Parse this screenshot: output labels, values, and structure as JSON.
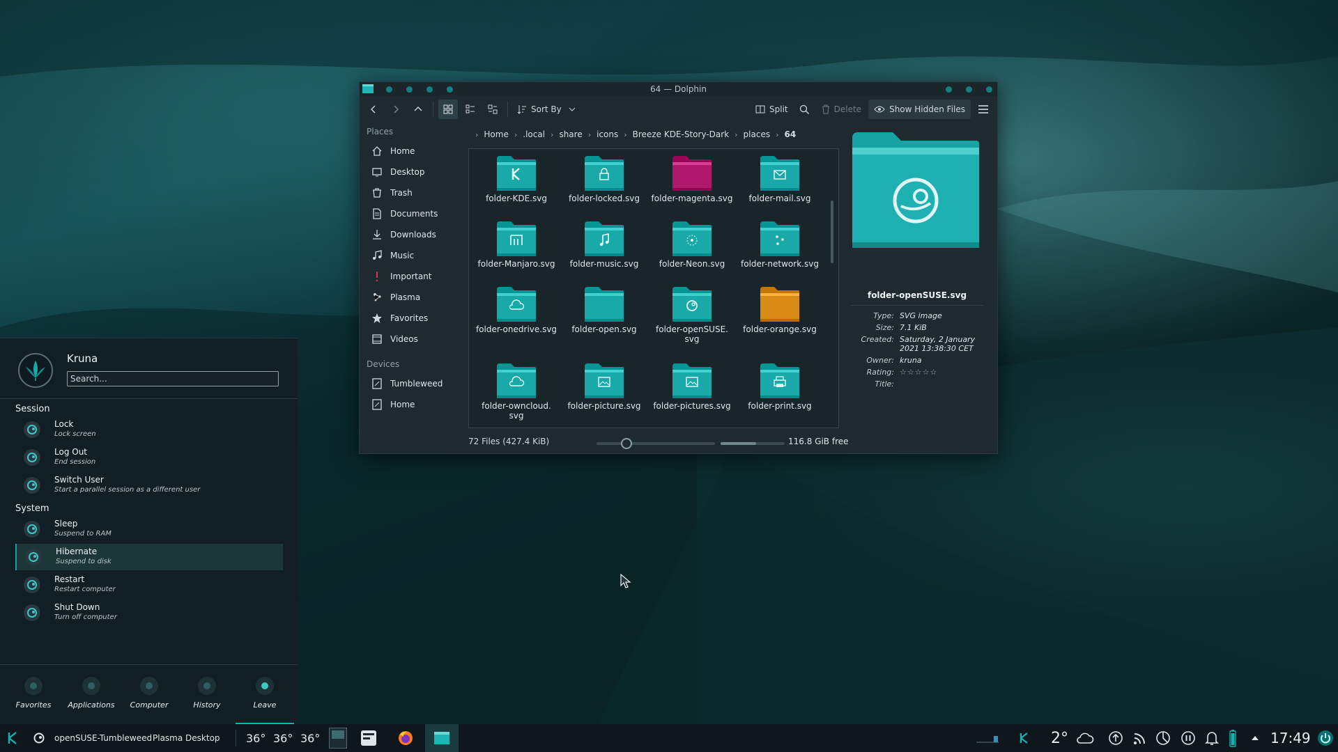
{
  "window": {
    "title": "64 — Dolphin",
    "toolbar": {
      "sort_label": "Sort By",
      "split_label": "Split",
      "delete_label": "Delete",
      "show_hidden_label": "Show Hidden Files"
    },
    "breadcrumbs": [
      "Home",
      ".local",
      "share",
      "icons",
      "Breeze KDE-Story-Dark",
      "places",
      "64"
    ],
    "places": {
      "section_places": "Places",
      "items": [
        {
          "label": "Home",
          "icon": "home-icon"
        },
        {
          "label": "Desktop",
          "icon": "desktop-icon"
        },
        {
          "label": "Trash",
          "icon": "trash-icon"
        },
        {
          "label": "Documents",
          "icon": "documents-icon"
        },
        {
          "label": "Downloads",
          "icon": "downloads-icon"
        },
        {
          "label": "Music",
          "icon": "music-icon"
        },
        {
          "label": "Important",
          "icon": "important-icon"
        },
        {
          "label": "Plasma",
          "icon": "plasma-icon"
        },
        {
          "label": "Favorites",
          "icon": "star-icon"
        },
        {
          "label": "Videos",
          "icon": "videos-icon"
        }
      ],
      "section_devices": "Devices",
      "devices": [
        {
          "label": "Tumbleweed",
          "icon": "drive-icon"
        },
        {
          "label": "Home",
          "icon": "drive-icon"
        }
      ]
    },
    "files": [
      {
        "name": "folder-KDE.svg",
        "color": "#1aa9a9",
        "emblem": "kde"
      },
      {
        "name": "folder-locked.svg",
        "color": "#1aa9a9",
        "emblem": "lock"
      },
      {
        "name": "folder-magenta.svg",
        "color": "#b0186d",
        "emblem": "none"
      },
      {
        "name": "folder-mail.svg",
        "color": "#1aa9a9",
        "emblem": "mail"
      },
      {
        "name": "folder-Manjaro.svg",
        "color": "#1aa9a9",
        "emblem": "manjaro"
      },
      {
        "name": "folder-music.svg",
        "color": "#1aa9a9",
        "emblem": "music"
      },
      {
        "name": "folder-Neon.svg",
        "color": "#1aa9a9",
        "emblem": "neon"
      },
      {
        "name": "folder-network.svg",
        "color": "#1aa9a9",
        "emblem": "network"
      },
      {
        "name": "folder-onedrive.svg",
        "color": "#1aa9a9",
        "emblem": "cloud"
      },
      {
        "name": "folder-open.svg",
        "color": "#1aa9a9",
        "emblem": "none"
      },
      {
        "name": "folder-openSUSE.\nsvg",
        "color": "#1aa9a9",
        "emblem": "suse"
      },
      {
        "name": "folder-orange.svg",
        "color": "#d98a15",
        "emblem": "none"
      },
      {
        "name": "folder-owncloud.\nsvg",
        "color": "#1aa9a9",
        "emblem": "cloud"
      },
      {
        "name": "folder-picture.svg",
        "color": "#1aa9a9",
        "emblem": "picture"
      },
      {
        "name": "folder-pictures.svg",
        "color": "#1aa9a9",
        "emblem": "picture"
      },
      {
        "name": "folder-print.svg",
        "color": "#1aa9a9",
        "emblem": "print"
      }
    ],
    "info_panel": {
      "name": "folder-openSUSE.svg",
      "rows": [
        {
          "key": "Type:",
          "value": "SVG image"
        },
        {
          "key": "Size:",
          "value": "7.1 KiB"
        },
        {
          "key": "Created:",
          "value": "Saturday, 2 January 2021 13:38:30 CET"
        },
        {
          "key": "Owner:",
          "value": "kruna"
        },
        {
          "key": "Rating:",
          "value": "☆☆☆☆☆"
        },
        {
          "key": "Title:",
          "value": ""
        }
      ]
    },
    "status": {
      "count": "72 Files (427.4 KiB)",
      "free": "116.8 GiB free",
      "free_used_fraction": 0.55,
      "zoom_level_fraction": 0.25
    }
  },
  "kickoff": {
    "user": "Kruna",
    "search_placeholder": "Search...",
    "session_label": "Session",
    "system_label": "System",
    "session_items": [
      {
        "title": "Lock",
        "subtitle": "Lock screen"
      },
      {
        "title": "Log Out",
        "subtitle": "End session"
      },
      {
        "title": "Switch User",
        "subtitle": "Start a parallel session as a different user"
      }
    ],
    "system_items": [
      {
        "title": "Sleep",
        "subtitle": "Suspend to RAM"
      },
      {
        "title": "Hibernate",
        "subtitle": "Suspend to disk"
      },
      {
        "title": "Restart",
        "subtitle": "Restart computer"
      },
      {
        "title": "Shut Down",
        "subtitle": "Turn off computer"
      }
    ],
    "tabs": [
      "Favorites",
      "Applications",
      "Computer",
      "History",
      "Leave"
    ],
    "active_tab": "Leave"
  },
  "taskbar": {
    "distro_label": "openSUSE-Tumbleweed",
    "activity_label": "Plasma Desktop",
    "temps": [
      "36°",
      "36°",
      "36°"
    ],
    "weather_temp": "2°",
    "clock": "17:49"
  },
  "colors": {
    "accent": "#17b0b0",
    "folder": "#1aa9a9",
    "magenta": "#b0186d",
    "orange": "#d98a15"
  }
}
